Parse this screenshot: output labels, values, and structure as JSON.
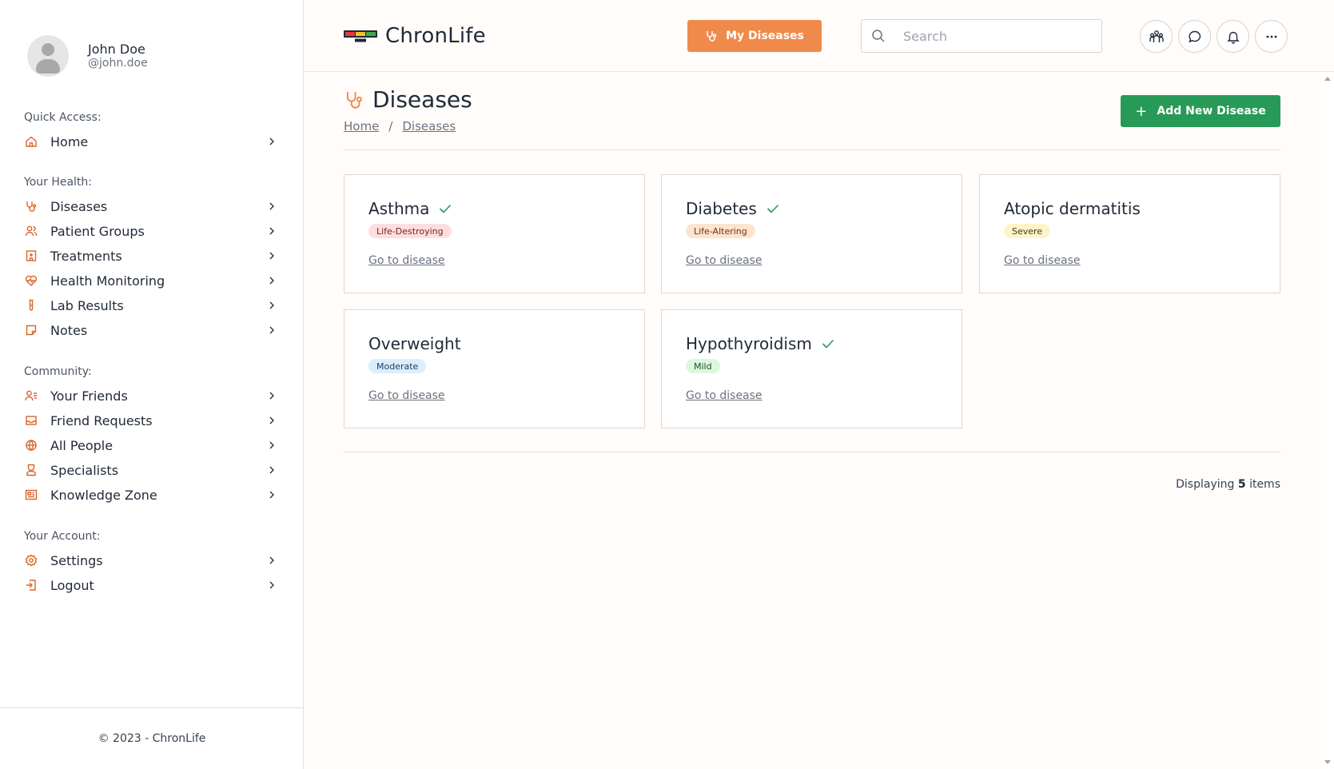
{
  "user": {
    "name": "John Doe",
    "handle": "@john.doe"
  },
  "sidebar": {
    "sections": [
      {
        "title": "Quick Access:",
        "items": [
          {
            "label": "Home",
            "icon": "home-icon"
          }
        ]
      },
      {
        "title": "Your Health:",
        "items": [
          {
            "label": "Diseases",
            "icon": "stethoscope-icon"
          },
          {
            "label": "Patient Groups",
            "icon": "users-icon"
          },
          {
            "label": "Treatments",
            "icon": "hospital-icon"
          },
          {
            "label": "Health Monitoring",
            "icon": "heart-pulse-icon"
          },
          {
            "label": "Lab Results",
            "icon": "test-tube-icon"
          },
          {
            "label": "Notes",
            "icon": "note-icon"
          }
        ]
      },
      {
        "title": "Community:",
        "items": [
          {
            "label": "Your Friends",
            "icon": "user-list-icon"
          },
          {
            "label": "Friend Requests",
            "icon": "inbox-icon"
          },
          {
            "label": "All People",
            "icon": "globe-icon"
          },
          {
            "label": "Specialists",
            "icon": "doctor-icon"
          },
          {
            "label": "Knowledge Zone",
            "icon": "newspaper-icon"
          }
        ]
      },
      {
        "title": "Your Account:",
        "items": [
          {
            "label": "Settings",
            "icon": "gear-icon"
          },
          {
            "label": "Logout",
            "icon": "logout-icon"
          }
        ]
      }
    ],
    "footer": "© 2023 - ChronLife"
  },
  "header": {
    "logo_text": "ChronLife",
    "my_diseases_label": "My Diseases",
    "search_placeholder": "Search",
    "icons": [
      "group-icon",
      "chat-icon",
      "bell-icon",
      "more-icon"
    ]
  },
  "page": {
    "title": "Diseases",
    "breadcrumb": [
      "Home",
      "Diseases"
    ],
    "breadcrumb_sep": "/",
    "add_button_label": "Add New Disease"
  },
  "diseases": [
    {
      "name": "Asthma",
      "checked": true,
      "severity": "Life-Destroying",
      "severity_bg": "#fddede",
      "severity_fg": "#7f1d1d",
      "link": "Go to disease"
    },
    {
      "name": "Diabetes",
      "checked": true,
      "severity": "Life-Altering",
      "severity_bg": "#fde4cf",
      "severity_fg": "#7c2d12",
      "link": "Go to disease"
    },
    {
      "name": "Atopic dermatitis",
      "checked": false,
      "severity": "Severe",
      "severity_bg": "#fdf5c9",
      "severity_fg": "#3f3a12",
      "link": "Go to disease"
    },
    {
      "name": "Overweight",
      "checked": false,
      "severity": "Moderate",
      "severity_bg": "#dbeefc",
      "severity_fg": "#1e3a5f",
      "link": "Go to disease"
    },
    {
      "name": "Hypothyroidism",
      "checked": true,
      "severity": "Mild",
      "severity_bg": "#dcf7dd",
      "severity_fg": "#14532d",
      "link": "Go to disease"
    }
  ],
  "footer": {
    "prefix": "Displaying",
    "count": "5",
    "suffix": "items"
  },
  "colors": {
    "accent": "#f08a4b",
    "accent_dark": "#d9652b",
    "success": "#279a57"
  }
}
